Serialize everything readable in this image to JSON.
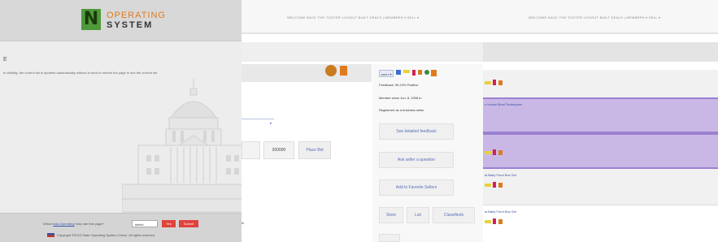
{
  "left": {
    "logo": {
      "mark": "N",
      "line1": "OPERATING",
      "line2": "SYSTEM"
    },
    "heading": "E",
    "notice": "is visibility, the current list is updated automatically without a need to refresh the page to see the current list.",
    "feedback": {
      "question_pre": "Which",
      "question_link": "kala-Operating",
      "question_post": "help rate this page?",
      "select_value": "select",
      "yes_label": "Yes",
      "no_label": "Submit",
      "copyright": "Copyright ©2019 State Operating System Check. All rights reserved."
    }
  },
  "middle": {
    "topnav": {
      "links": "WELCOME BACK THE TOOTER   LOGOUT   BUILT DEALS   |   MEMBERS ▾   SELL ▾"
    },
    "tick_text": "▸",
    "quantity_value": "",
    "bid_value": "200000",
    "place_bid_label": "Place Bid",
    "fragment": "ls",
    "seller_card": {
      "select_label": "sam-t ▾",
      "feedback": "Feedback: 99.22% Positive",
      "member_since": "Member since Jun. 8, 2008 in",
      "registered": "Registered as a business seller",
      "btn_feedback": "See detailed feedback",
      "btn_question": "Ask seller a question",
      "btn_favorite": "Add to Favorite Sellers",
      "btn_store": "Store",
      "btn_list": "List",
      "btn_classifieds": "Classifieds"
    }
  },
  "right": {
    "topnav": {
      "links": "WELCOME BACK THE TOOTER   LOGOUT   BUILT DEALS   |   MEMBERS ▾   SELL ▾"
    },
    "rows": [
      {
        "title": ""
      },
      {
        "title": "n Incoert Bost Techniques"
      },
      {
        "title": ""
      },
      {
        "title": "la Baby Form Box Set"
      },
      {
        "title": "la Baby Form Box Set"
      }
    ]
  }
}
